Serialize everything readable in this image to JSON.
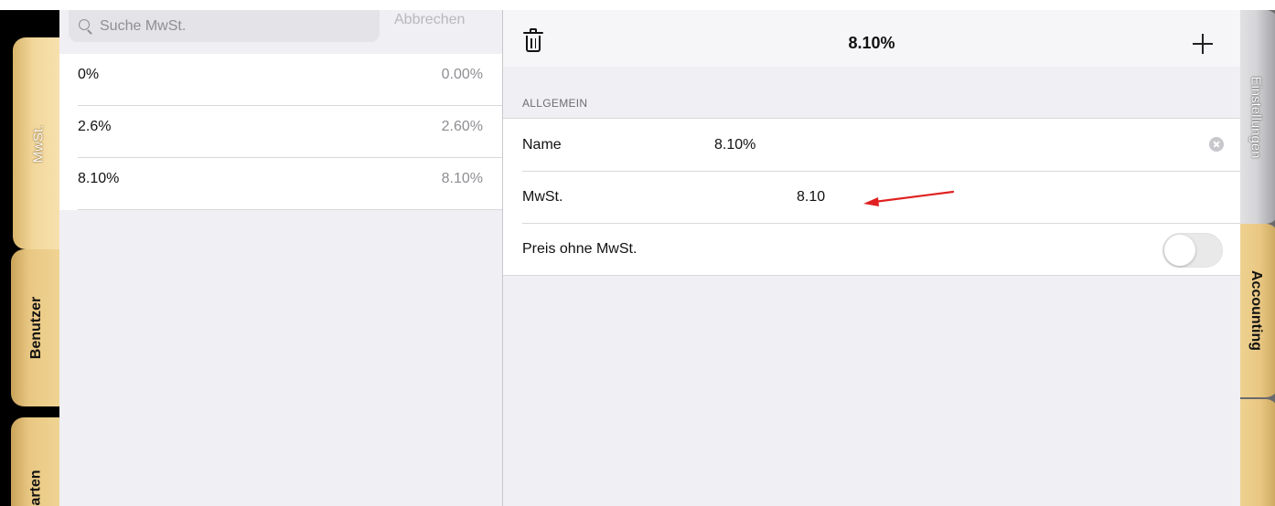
{
  "search": {
    "placeholder": "Suche MwSt.",
    "cancel_label": "Abbrechen"
  },
  "left_tabs": [
    {
      "label": "MwSt.",
      "active": true
    },
    {
      "label": "Benutzer",
      "active": false
    },
    {
      "label": "arten",
      "active": false
    }
  ],
  "vat_list": [
    {
      "name": "0%",
      "value": "0.00%"
    },
    {
      "name": "2.6%",
      "value": "2.60%"
    },
    {
      "name": "8.10%",
      "value": "8.10%"
    }
  ],
  "detail": {
    "title": "8.10%",
    "section_header": "ALLGEMEIN",
    "rows": {
      "name": {
        "label": "Name",
        "value": "8.10%"
      },
      "vat": {
        "label": "MwSt.",
        "value": "8.10"
      },
      "price_without_vat": {
        "label": "Preis ohne MwSt.",
        "enabled": false
      }
    }
  },
  "right_tabs": [
    {
      "label": "Einstellungen"
    },
    {
      "label": "Accounting"
    }
  ],
  "colors": {
    "tab_gold": "#e8c782",
    "annotation_arrow": "#e02020",
    "toggle_off": "#e9e9ea"
  }
}
